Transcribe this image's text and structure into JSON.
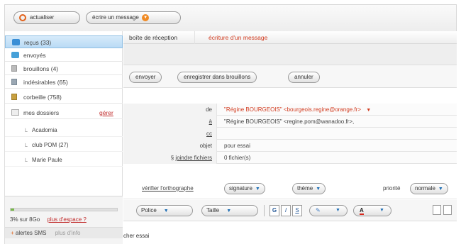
{
  "toolbar": {
    "refresh_label": "actualiser",
    "write_label": "écrire un message"
  },
  "sidebar": {
    "folders": [
      {
        "label": "reçus (33)"
      },
      {
        "label": "envoyés"
      },
      {
        "label": "brouillons (4)"
      },
      {
        "label": "indésirables (65)"
      },
      {
        "label": "corbeille (758)"
      },
      {
        "label": "mes dossiers"
      }
    ],
    "manage_label": "gérer",
    "subfolders": [
      {
        "label": "Acadomia"
      },
      {
        "label": "club POM (27)"
      },
      {
        "label": "Marie Paule"
      }
    ],
    "quota": {
      "used_fraction": 0.03,
      "text": "3% sur 8Go",
      "link": "plus d'espace ?"
    },
    "sms": {
      "label": "alertes SMS",
      "more": "plus d'info"
    }
  },
  "main": {
    "breadcrumb": {
      "root": "boîte de réception",
      "current": "écriture d'un message"
    },
    "actions": {
      "send": "envoyer",
      "save_draft": "enregistrer dans brouillons",
      "cancel": "annuler"
    },
    "header_fields": {
      "from_label": "de",
      "from_value": "\"Régine BOURGEOIS\" <bourgeois.regine@orange.fr>",
      "to_label": "à",
      "to_value": "\"Régine BOURGEOIS\" <regine.pom@wanadoo.fr>,",
      "cc_label": "cc",
      "cc_value": "",
      "subject_label": "objet",
      "subject_value": "pour essai",
      "attach_label": "joindre fichiers",
      "attach_value": "0 fichier(s)"
    },
    "tools": {
      "spellcheck": "vérifier l'orthographe",
      "signature": "signature",
      "theme": "thème",
      "priority_label": "priorité",
      "priority_value": "normale"
    },
    "format": {
      "font": "Police",
      "size": "Taille",
      "bold": "G",
      "italic": "I",
      "underline": "S"
    },
    "body": "cher essai"
  }
}
